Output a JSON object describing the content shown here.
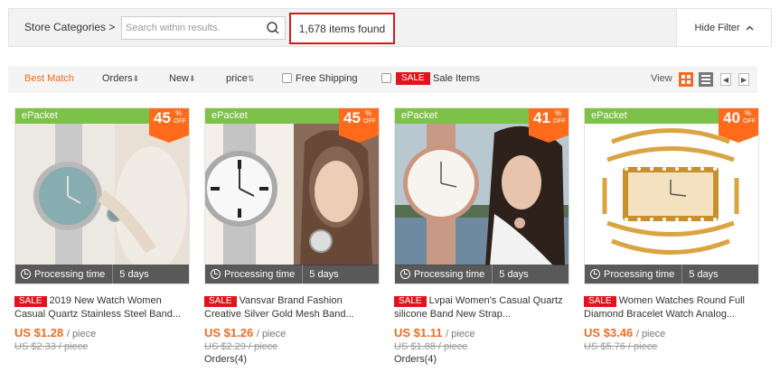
{
  "topbar": {
    "store_categories": "Store Categories >",
    "search_placeholder": "Search within results.",
    "items_found": "1,678 items found",
    "hide_filter": "Hide Filter",
    "hide_filter_icon": "chevron-up-icon"
  },
  "sortbar": {
    "best_match": "Best Match",
    "orders": "Orders",
    "new": "New",
    "price": "price",
    "free_shipping": "Free Shipping",
    "sale_tag": "SALE",
    "sale_items": "Sale Items",
    "view": "View",
    "accent_color": "#f26c1f"
  },
  "products": [
    {
      "epacket": "ePacket",
      "discount": "45",
      "processing_label": "Processing time",
      "processing_value": "5 days",
      "sale": "SALE",
      "title": "2019 New Watch Women Casual Quartz Stainless Steel Band...",
      "price": "US $1.28",
      "unit": "/ piece",
      "old_price": "US $2.33 / piece",
      "orders": ""
    },
    {
      "epacket": "ePacket",
      "discount": "45",
      "processing_label": "Processing time",
      "processing_value": "5 days",
      "sale": "SALE",
      "title": "Vansvar Brand Fashion Creative Silver Gold Mesh Band...",
      "price": "US $1.26",
      "unit": "/ piece",
      "old_price": "US $2.29 / piece",
      "orders": "Orders(4)"
    },
    {
      "epacket": "ePacket",
      "discount": "41",
      "processing_label": "Processing time",
      "processing_value": "5 days",
      "sale": "SALE",
      "title": "Lvpai Women's Casual Quartz silicone Band New Strap...",
      "price": "US $1.11",
      "unit": "/ piece",
      "old_price": "US $1.88 / piece",
      "orders": "Orders(4)"
    },
    {
      "epacket": "ePacket",
      "discount": "40",
      "processing_label": "Processing time",
      "processing_value": "5 days",
      "sale": "SALE",
      "title": "Women Watches Round Full Diamond Bracelet Watch Analog...",
      "price": "US $3.46",
      "unit": "/ piece",
      "old_price": "US $5.76 / piece",
      "orders": ""
    }
  ],
  "discount_pct_symbol": "%",
  "discount_off": "OFF"
}
